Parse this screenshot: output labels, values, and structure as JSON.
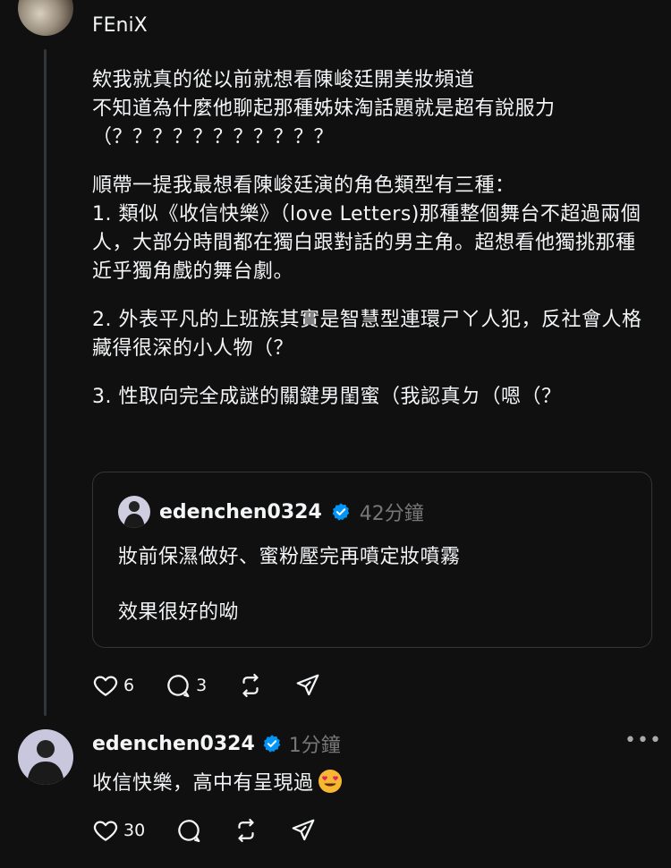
{
  "post": {
    "author": "FEniX",
    "paragraphs": [
      "欸我就真的從以前就想看陳峻廷開美妝頻道\n不知道為什麼他聊起那種姊妹淘話題就是超有說服力\n（？？？？？？？？？？？",
      "順帶一提我最想看陳峻廷演的角色類型有三種：\n1. 類似《收信快樂》（love Letters)那種整個舞台不超過兩個人，大部分時間都在獨白跟對話的男主角。超想看他獨挑那種近乎獨角戲的舞台劇。",
      "2. 外表平凡的上班族其實是智慧型連環ㄕㄚ人犯，反社會人格藏得很深的小人物（？",
      "3. 性取向完全成謎的關鍵男閨蜜（我認真ㄉ（嗯（？"
    ],
    "quote": {
      "author": "edenchen0324",
      "time": "42分鐘",
      "line1": "妝前保濕做好、蜜粉壓完再噴定妝噴霧",
      "line2": "效果很好的呦"
    },
    "likes": "6",
    "replies": "3"
  },
  "reply": {
    "author": "edenchen0324",
    "time": "1分鐘",
    "text": "收信快樂，高中有呈現過",
    "more": "•••",
    "likes": "30"
  },
  "icons": {
    "like": "heart-icon",
    "comment": "comment-icon",
    "repost": "repost-icon",
    "share": "send-icon",
    "verified": "verified-badge-icon",
    "emoji": "heart-eyes-emoji"
  },
  "colors": {
    "background": "#101010",
    "text": "#f3f5f7",
    "muted": "#777777",
    "verified": "#0095f6"
  }
}
